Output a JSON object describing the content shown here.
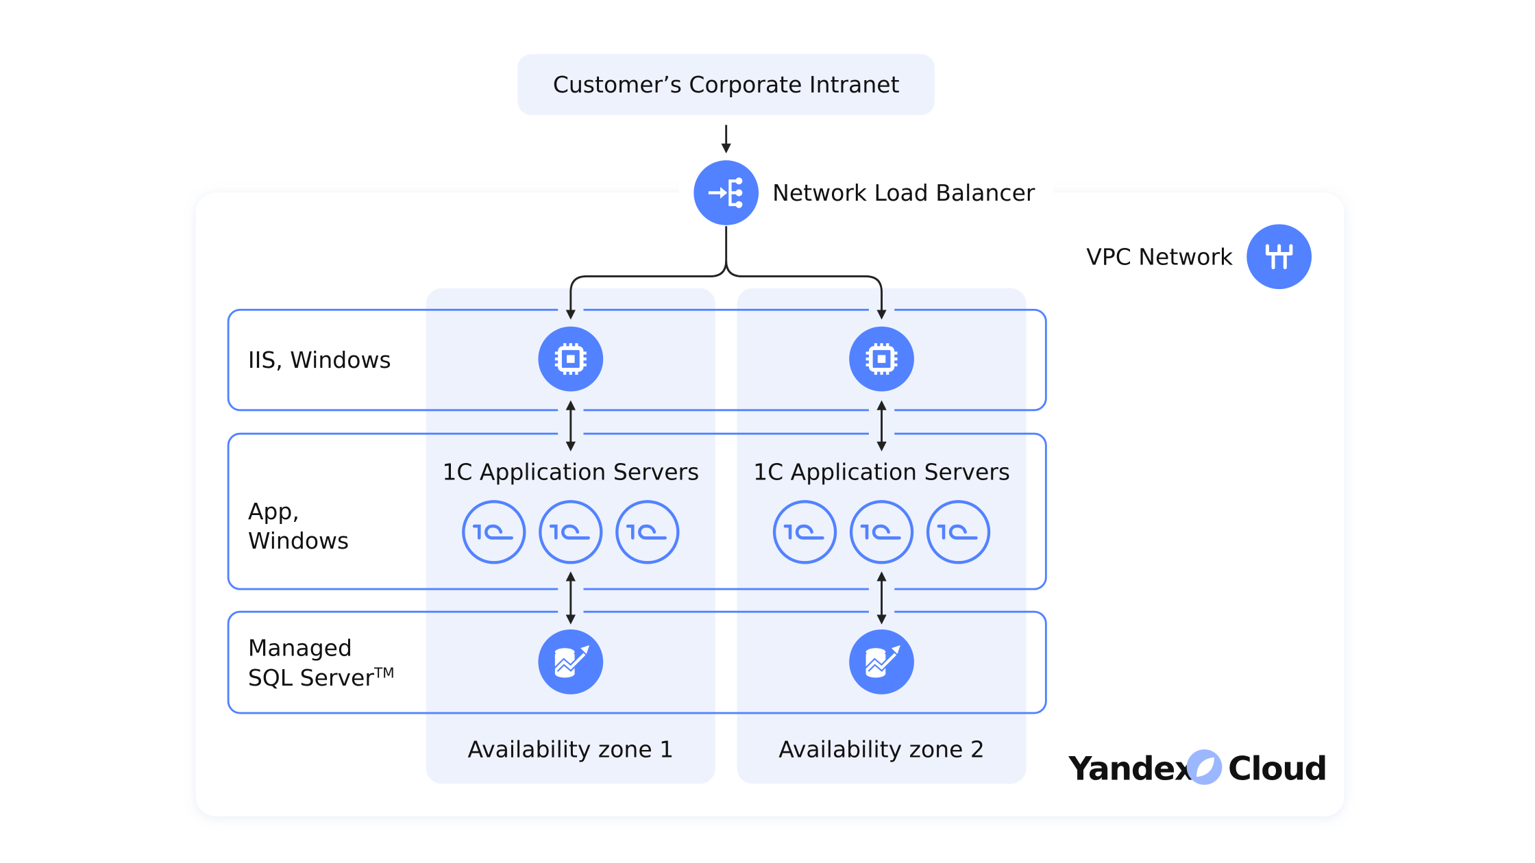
{
  "colors": {
    "accent": "#5282ff",
    "zone_fill": "#eef2fd",
    "panel": "#ffffff",
    "arrow": "#222222"
  },
  "intranet": {
    "label": "Customer’s Corporate Intranet"
  },
  "load_balancer": {
    "label": "Network Load Balancer",
    "icon": "load-balancer-icon"
  },
  "vpc": {
    "label": "VPC Network",
    "icon": "network-icon"
  },
  "rows": {
    "iis": {
      "label": "IIS, Windows",
      "icon": "cpu-chip-icon"
    },
    "app": {
      "label_line1": "App,",
      "label_line2": "Windows",
      "servers_title": "1C Application Servers",
      "icon": "1c-icon"
    },
    "sql": {
      "label_line1": "Managed",
      "label_line2": "SQL Server",
      "label_tm": "TM",
      "icon": "database-chart-icon"
    }
  },
  "zones": [
    {
      "label": "Availability zone 1"
    },
    {
      "label": "Availability zone 2"
    }
  ],
  "logo": {
    "text_left": "Yandex",
    "text_right": "Cloud"
  }
}
